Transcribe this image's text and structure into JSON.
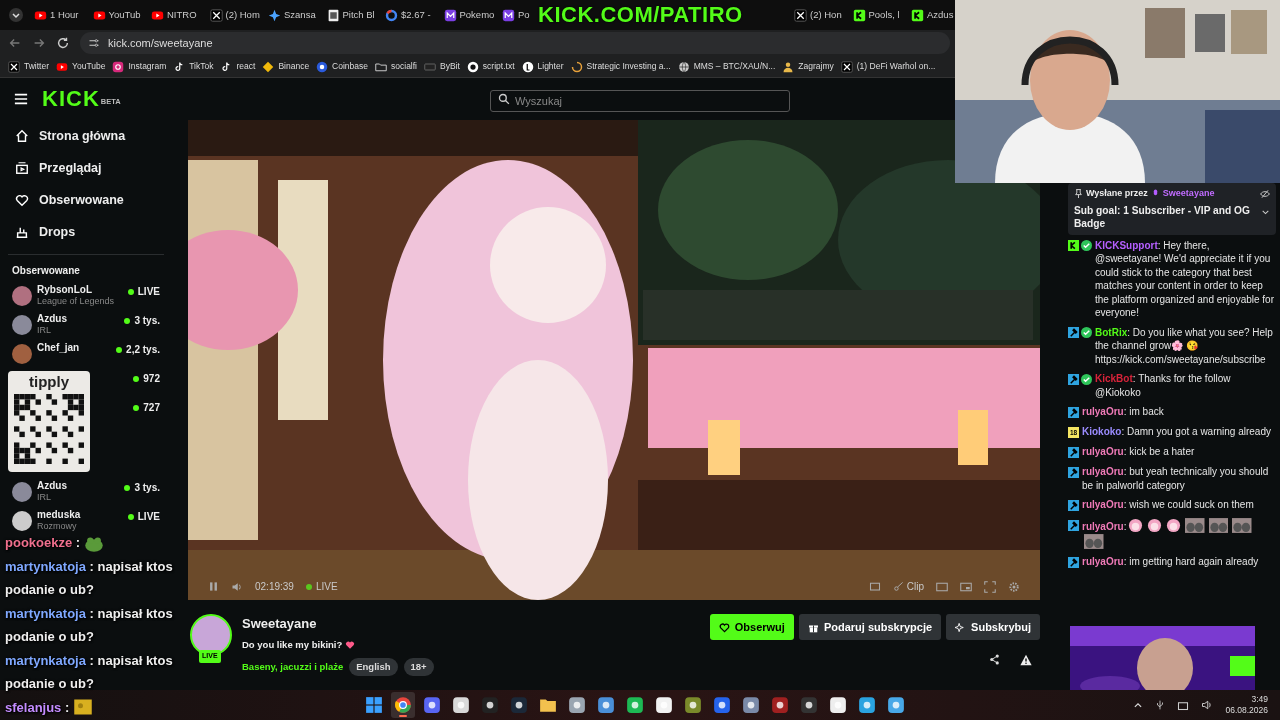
{
  "browser": {
    "tabs": [
      {
        "title": "1 Hour",
        "kind": "youtube"
      },
      {
        "title": "YouTub",
        "kind": "youtube"
      },
      {
        "title": "NITRO",
        "kind": "youtube"
      },
      {
        "title": "(2) Hom",
        "kind": "x"
      },
      {
        "title": "Szansa",
        "kind": "spark"
      },
      {
        "title": "Pitch Bl",
        "kind": "page"
      },
      {
        "title": "$2.67 -",
        "kind": "google"
      },
      {
        "title": "Pokemo",
        "kind": "m"
      },
      {
        "title": "Po",
        "kind": "m"
      },
      {
        "title": "(2) Hon",
        "kind": "x"
      },
      {
        "title": "Pools, l",
        "kind": "kick"
      },
      {
        "title": "Azdus",
        "kind": "kick"
      }
    ],
    "address": "kick.com/sweetayane",
    "bookmarks": [
      {
        "label": "Twitter",
        "kind": "x"
      },
      {
        "label": "YouTube",
        "kind": "youtube"
      },
      {
        "label": "Instagram",
        "kind": "instagram"
      },
      {
        "label": "TikTok",
        "kind": "tiktok"
      },
      {
        "label": "react",
        "kind": "tiktok"
      },
      {
        "label": "Binance",
        "kind": "binance"
      },
      {
        "label": "Coinbase",
        "kind": "coinbase"
      },
      {
        "label": "socialfi",
        "kind": "folder"
      },
      {
        "label": "ByBit",
        "kind": "bybit"
      },
      {
        "label": "script.txt",
        "kind": "github"
      },
      {
        "label": "Lighter",
        "kind": "lighter"
      },
      {
        "label": "Strategic Investing a...",
        "kind": "loader"
      },
      {
        "label": "MMS – BTC/XAU/N...",
        "kind": "globe"
      },
      {
        "label": "Zagrajmy",
        "kind": "person"
      },
      {
        "label": "(1) DeFi Warhol on...",
        "kind": "x"
      }
    ]
  },
  "overlay_banner": "KICK.COM/PATIRO",
  "kick": {
    "logo": "KICK",
    "logo_badge": "BETA",
    "search": {
      "placeholder": "Wyszukaj"
    },
    "nav": [
      {
        "label": "Strona główna",
        "kind": "home"
      },
      {
        "label": "Przeglądaj",
        "kind": "browse"
      },
      {
        "label": "Obserwowane",
        "kind": "heart"
      },
      {
        "label": "Drops",
        "kind": "drops"
      }
    ],
    "followed_title": "Obserwowane",
    "followed": [
      {
        "name": "RybsonLoL",
        "category": "League of Legends",
        "viewers": "LIVE"
      },
      {
        "name": "Azdus",
        "category": "IRL",
        "viewers": "3 tys."
      },
      {
        "name": "Chef_jan",
        "viewers": "2,2 tys."
      },
      {
        "viewers": "972"
      },
      {
        "viewers": "727"
      },
      {
        "kind": "hidden"
      },
      {
        "name": "Azdus",
        "category": "IRL",
        "viewers": "3 tys."
      },
      {
        "name": "meduska",
        "category": "Rozmowy",
        "viewers": "LIVE"
      }
    ],
    "player": {
      "time": "02:19:39",
      "status": "LIVE",
      "clip": "Clip"
    },
    "stream": {
      "name": "Sweetayane",
      "live": "LIVE",
      "title": "Do you like my bikini?",
      "category": "Baseny, jacuzzi i plaże",
      "tags": [
        "English",
        "18+"
      ],
      "buttons": [
        {
          "label": "Obserwuj",
          "kind": "follow"
        },
        {
          "label": "Podaruj subskrypcje",
          "kind": "gift"
        },
        {
          "label": "Subskrybuj",
          "kind": "sub"
        }
      ]
    },
    "chat": {
      "pinned": {
        "label": "Wysłane przez",
        "user": "Sweetayane",
        "text": "Sub goal: 1 Subscriber - VIP and OG Badge"
      },
      "messages": [
        {
          "badges": [
            {
              "kind": "kick"
            },
            {
              "kind": "verified"
            }
          ],
          "user": "KICKSupport",
          "color": "#b560ff",
          "text": ": Hey there, @sweetayane! We'd appreciate it if you could stick to the category that best matches your content in order to keep the platform organized and enjoyable for everyone!"
        },
        {
          "badges": [
            {
              "kind": "mod"
            },
            {
              "kind": "verified"
            }
          ],
          "user": "BotRix",
          "color": "#53fc18",
          "text": ": Do you like what you see? Help the channel grow🌸 😘 https://kick.com/sweetayane/subscribe"
        },
        {
          "badges": [
            {
              "kind": "mod"
            },
            {
              "kind": "verified"
            }
          ],
          "user": "KickBot",
          "color": "#d8233a",
          "text": ": Thanks for the follow @Kiokoko"
        },
        {
          "badges": [
            {
              "kind": "mod"
            }
          ],
          "user": "rulyaOru",
          "color": "#f07ab8",
          "text": ": im back"
        },
        {
          "badges": [
            {
              "kind": "months",
              "text": "18"
            }
          ],
          "user": "Kiokoko",
          "color": "#9b8cff",
          "text": ": Damn you got a warning already"
        },
        {
          "badges": [
            {
              "kind": "mod"
            }
          ],
          "user": "rulyaOru",
          "color": "#f07ab8",
          "text": ": kick be a hater"
        },
        {
          "badges": [
            {
              "kind": "mod"
            }
          ],
          "user": "rulyaOru",
          "color": "#f07ab8",
          "text": ": but yeah technically you should be in palworld category"
        },
        {
          "badges": [
            {
              "kind": "mod"
            }
          ],
          "user": "rulyaOru",
          "color": "#f07ab8",
          "text": ": wish we could suck on them"
        },
        {
          "badges": [
            {
              "kind": "mod"
            }
          ],
          "user": "rulyaOru",
          "color": "#f07ab8",
          "text": ":",
          "emotes": [
            {
              "kind": "face"
            },
            {
              "kind": "face"
            },
            {
              "kind": "face"
            },
            {
              "kind": "pair"
            },
            {
              "kind": "pair"
            },
            {
              "kind": "pair"
            },
            {
              "kind": "pair"
            }
          ]
        },
        {
          "badges": [
            {
              "kind": "mod"
            }
          ],
          "user": "rulyaOru",
          "color": "#f07ab8",
          "text": ": im getting hard again already"
        }
      ]
    }
  },
  "tipply": {
    "label": "tipply"
  },
  "stream_overlay_chat": [
    {
      "user": "pookoekze",
      "color": "#f0708e",
      "text": ":",
      "emote": {
        "kind": "frog"
      }
    },
    {
      "user": "martynkatoja",
      "color": "#7fa8ff",
      "text": ": napisał ktos podanie o ub?"
    },
    {
      "user": "martynkatoja",
      "color": "#7fa8ff",
      "text": ": napisał ktos podanie o ub?"
    },
    {
      "user": "martynkatoja",
      "color": "#7fa8ff",
      "text": ": napisał ktos podanie o ub?"
    },
    {
      "user": "sfelanjus",
      "color": "#c48cff",
      "text": ":",
      "emote": {
        "kind": "cheese"
      }
    }
  ],
  "taskbar": {
    "apps": [
      {
        "kind": "start",
        "selected": false
      },
      {
        "kind": "chrome",
        "selected": true
      },
      {
        "kind": "discord",
        "selected": false
      },
      {
        "kind": "snip",
        "selected": false
      },
      {
        "kind": "obs",
        "selected": false
      },
      {
        "kind": "steam",
        "selected": false
      },
      {
        "kind": "folder",
        "selected": false
      },
      {
        "kind": "ccleaner",
        "selected": false
      },
      {
        "kind": "pinwheel",
        "selected": false
      },
      {
        "kind": "spotify",
        "selected": false
      },
      {
        "kind": "drive",
        "selected": false
      },
      {
        "kind": "loop",
        "selected": false
      },
      {
        "kind": "cross",
        "selected": false
      },
      {
        "kind": "game",
        "selected": false
      },
      {
        "kind": "redgame",
        "selected": false
      },
      {
        "kind": "rl",
        "selected": false
      },
      {
        "kind": "triangle",
        "selected": false
      },
      {
        "kind": "telegram",
        "selected": false
      },
      {
        "kind": "notepad",
        "selected": false
      }
    ],
    "time": "3:49",
    "date": "06.08.2026"
  }
}
